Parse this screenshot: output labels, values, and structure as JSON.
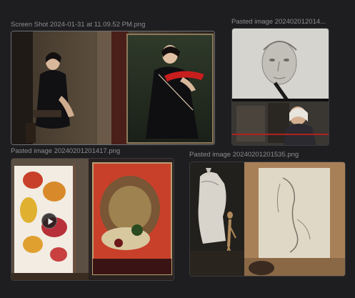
{
  "canvas": {
    "background": "#1e1e20",
    "cards": [
      {
        "title": "Screen Shot 2024-01-31 at 11.09.52 PM.png"
      },
      {
        "title": "Pasted image 202402012014..."
      },
      {
        "title": "Pasted image 20240201201417.png",
        "has_video_play": true
      },
      {
        "title": "Pasted image 20240201201535.png"
      }
    ]
  },
  "colors": {
    "title_text": "#8d8d92",
    "card_border": "#3a3a3e",
    "violin_red": "#c81e1e"
  },
  "icons": {
    "video_play": "play-icon"
  }
}
